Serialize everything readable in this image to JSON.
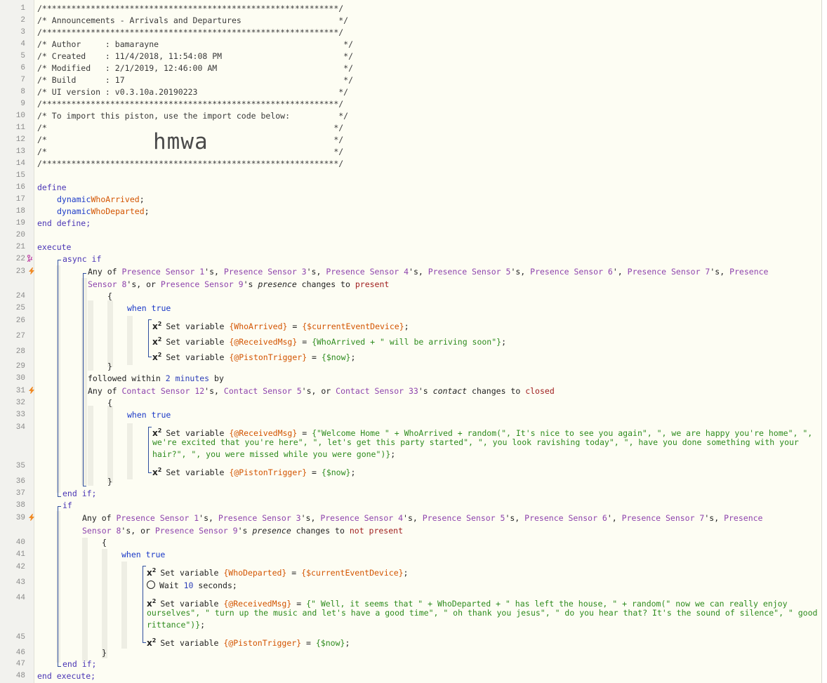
{
  "gutter": {
    "line_numbers": [
      "1",
      "2",
      "3",
      "4",
      "5",
      "6",
      "7",
      "8",
      "9",
      "10",
      "11",
      "12",
      "13",
      "14",
      "15",
      "16",
      "17",
      "18",
      "19",
      "20",
      "21",
      "22",
      "23",
      "24",
      "25",
      "26",
      "27",
      "28",
      "29",
      "30",
      "31",
      "32",
      "33",
      "34",
      "35",
      "36",
      "37",
      "38",
      "39",
      "40",
      "41",
      "42",
      "43",
      "44",
      "45",
      "46",
      "47",
      "48"
    ]
  },
  "header": {
    "border": "/*************************************************************/",
    "title": "/* Announcements - Arrivals and Departures                    */",
    "author": "/* Author     : bamarayne                                      */",
    "created": "/* Created    : 11/4/2018, 11:54:08 PM                         */",
    "modified": "/* Modified   : 2/1/2019, 12:46:00 AM                          */",
    "build": "/* Build      : 17                                             */",
    "ui_version": "/* UI version : v0.3.10a.20190223                             */",
    "import_note": "/* To import this piston, use the import code below:          */",
    "blank": "/*                                                           */",
    "import_code": "hmwa"
  },
  "code": {
    "define": "define",
    "dynamic": "dynamic",
    "who_arrived": "WhoArrived",
    "who_departed": "WhoDeparted",
    "semicolon": ";",
    "end_define": "end define;",
    "execute": "execute",
    "async_if": "async if",
    "if": "if",
    "end_if": "end if;",
    "end_execute": "end execute;",
    "brace_open": "{",
    "brace_close": "}",
    "when_true": "when true",
    "any_of": "Any of ",
    "presence_attr": "presence",
    "contact_attr": "contact",
    "changes_to": " changes to ",
    "present": "present",
    "not_present": "not present",
    "closed": "closed",
    "followed_within": "followed within ",
    "two_minutes": "2 minutes",
    "by": " by",
    "set_variable": "Set variable ",
    "wait": "Wait ",
    "ten": "10",
    "seconds": " seconds;",
    "equals": " = ",
    "v_who_arrived": "{WhoArrived}",
    "v_who_departed": "{WhoDeparted}",
    "v_received_msg": "{@ReceivedMsg}",
    "v_piston_trigger": "{@PistonTrigger}",
    "e_current_event_device": "{$currentEventDevice}",
    "e_now": "{$now}",
    "e_arriving": "{WhoArrived + \" will be arriving soon\"}",
    "e_welcome_1": "{\"Welcome Home \" + WhoArrived + random(\", It's nice to see you again\", \", we are happy you're home\", \",",
    "e_welcome_2": "we're excited that you're here\", \", let's get this party started\", \", you look ravishing today\", \", have you done something with your",
    "e_welcome_3": "hair?\", \", you were missed while you were gone\")}",
    "e_left_1": "{\" Well, it seems that \" + WhoDeparted + \" has left the house, \" + random(\" now we can really enjoy",
    "e_left_2": "ourselves\", \" turn up the music and let's have a good time\", \" oh thank you jesus\", \" do you hear that? It's the sound of silence\", \" good",
    "e_left_3": "rittance\")}",
    "presence_sensors": [
      "Presence Sensor 1",
      "Presence Sensor 3",
      "Presence Sensor 4",
      "Presence Sensor 5",
      "Presence Sensor 6",
      "Presence Sensor 7"
    ],
    "presence_8a": "Presence",
    "presence_8b": "Sensor 8",
    "presence_9": "Presence Sensor 9",
    "contact_sensors": [
      "Contact Sensor 12",
      "Contact Sensor 5",
      "Contact Sensor 33"
    ],
    "apos_s": "'s",
    "apos": "'",
    "comma_sep": "'s, ",
    "or_sep": "'s, or ",
    "x2": "x",
    "x2_sup": "2"
  },
  "colors": {
    "background": "#fdfdf3",
    "keyword": "#1b39c7",
    "variable": "#d35400",
    "device": "#8e44ad",
    "string": "#2e8b1e",
    "bracket": "#2f4f9f",
    "bolt": "#f08a24"
  },
  "icons": [
    "lightning-bolt-icon",
    "branch-icon",
    "set-variable-icon",
    "clock-icon"
  ]
}
